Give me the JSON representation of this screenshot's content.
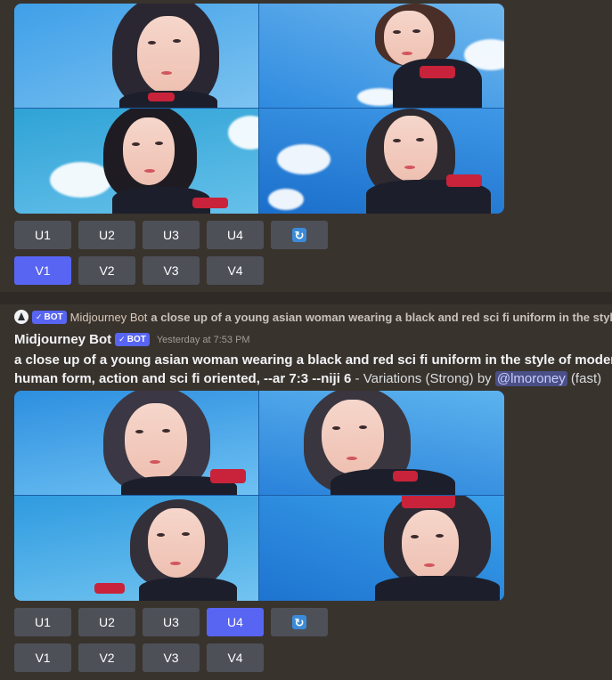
{
  "message_top": {
    "upscale_buttons": [
      "U1",
      "U2",
      "U3",
      "U4"
    ],
    "variation_buttons": [
      "V1",
      "V2",
      "V3",
      "V4"
    ],
    "active_variation": "V1",
    "reroll_icon": "refresh-icon"
  },
  "reply": {
    "badge": "BOT",
    "bot_name": "Midjourney Bot",
    "prompt_preview": "a close up of a young asian woman wearing a black and red sci fi uniform in the style"
  },
  "message": {
    "author": "Midjourney Bot",
    "badge": "BOT",
    "timestamp": "Yesterday at 7:53 PM",
    "prompt_line1": "a close up of a young asian woman wearing a black and red sci fi uniform in the style of modern",
    "prompt_line2": "human form, action and sci fi oriented, --ar 7:3 --niji 6",
    "variation_text": " - Variations (Strong) by ",
    "mention": "@lmoroney",
    "speed": " (fast)",
    "upscale_buttons": [
      "U1",
      "U2",
      "U3",
      "U4"
    ],
    "variation_buttons": [
      "V1",
      "V2",
      "V3",
      "V4"
    ],
    "active_upscale": "U4",
    "reroll_icon": "refresh-icon"
  },
  "colors": {
    "background": "#39332e",
    "button": "#4e5058",
    "button_active": "#5865f2",
    "bot_badge": "#5865f2",
    "mention_bg": "#4b4f87"
  }
}
